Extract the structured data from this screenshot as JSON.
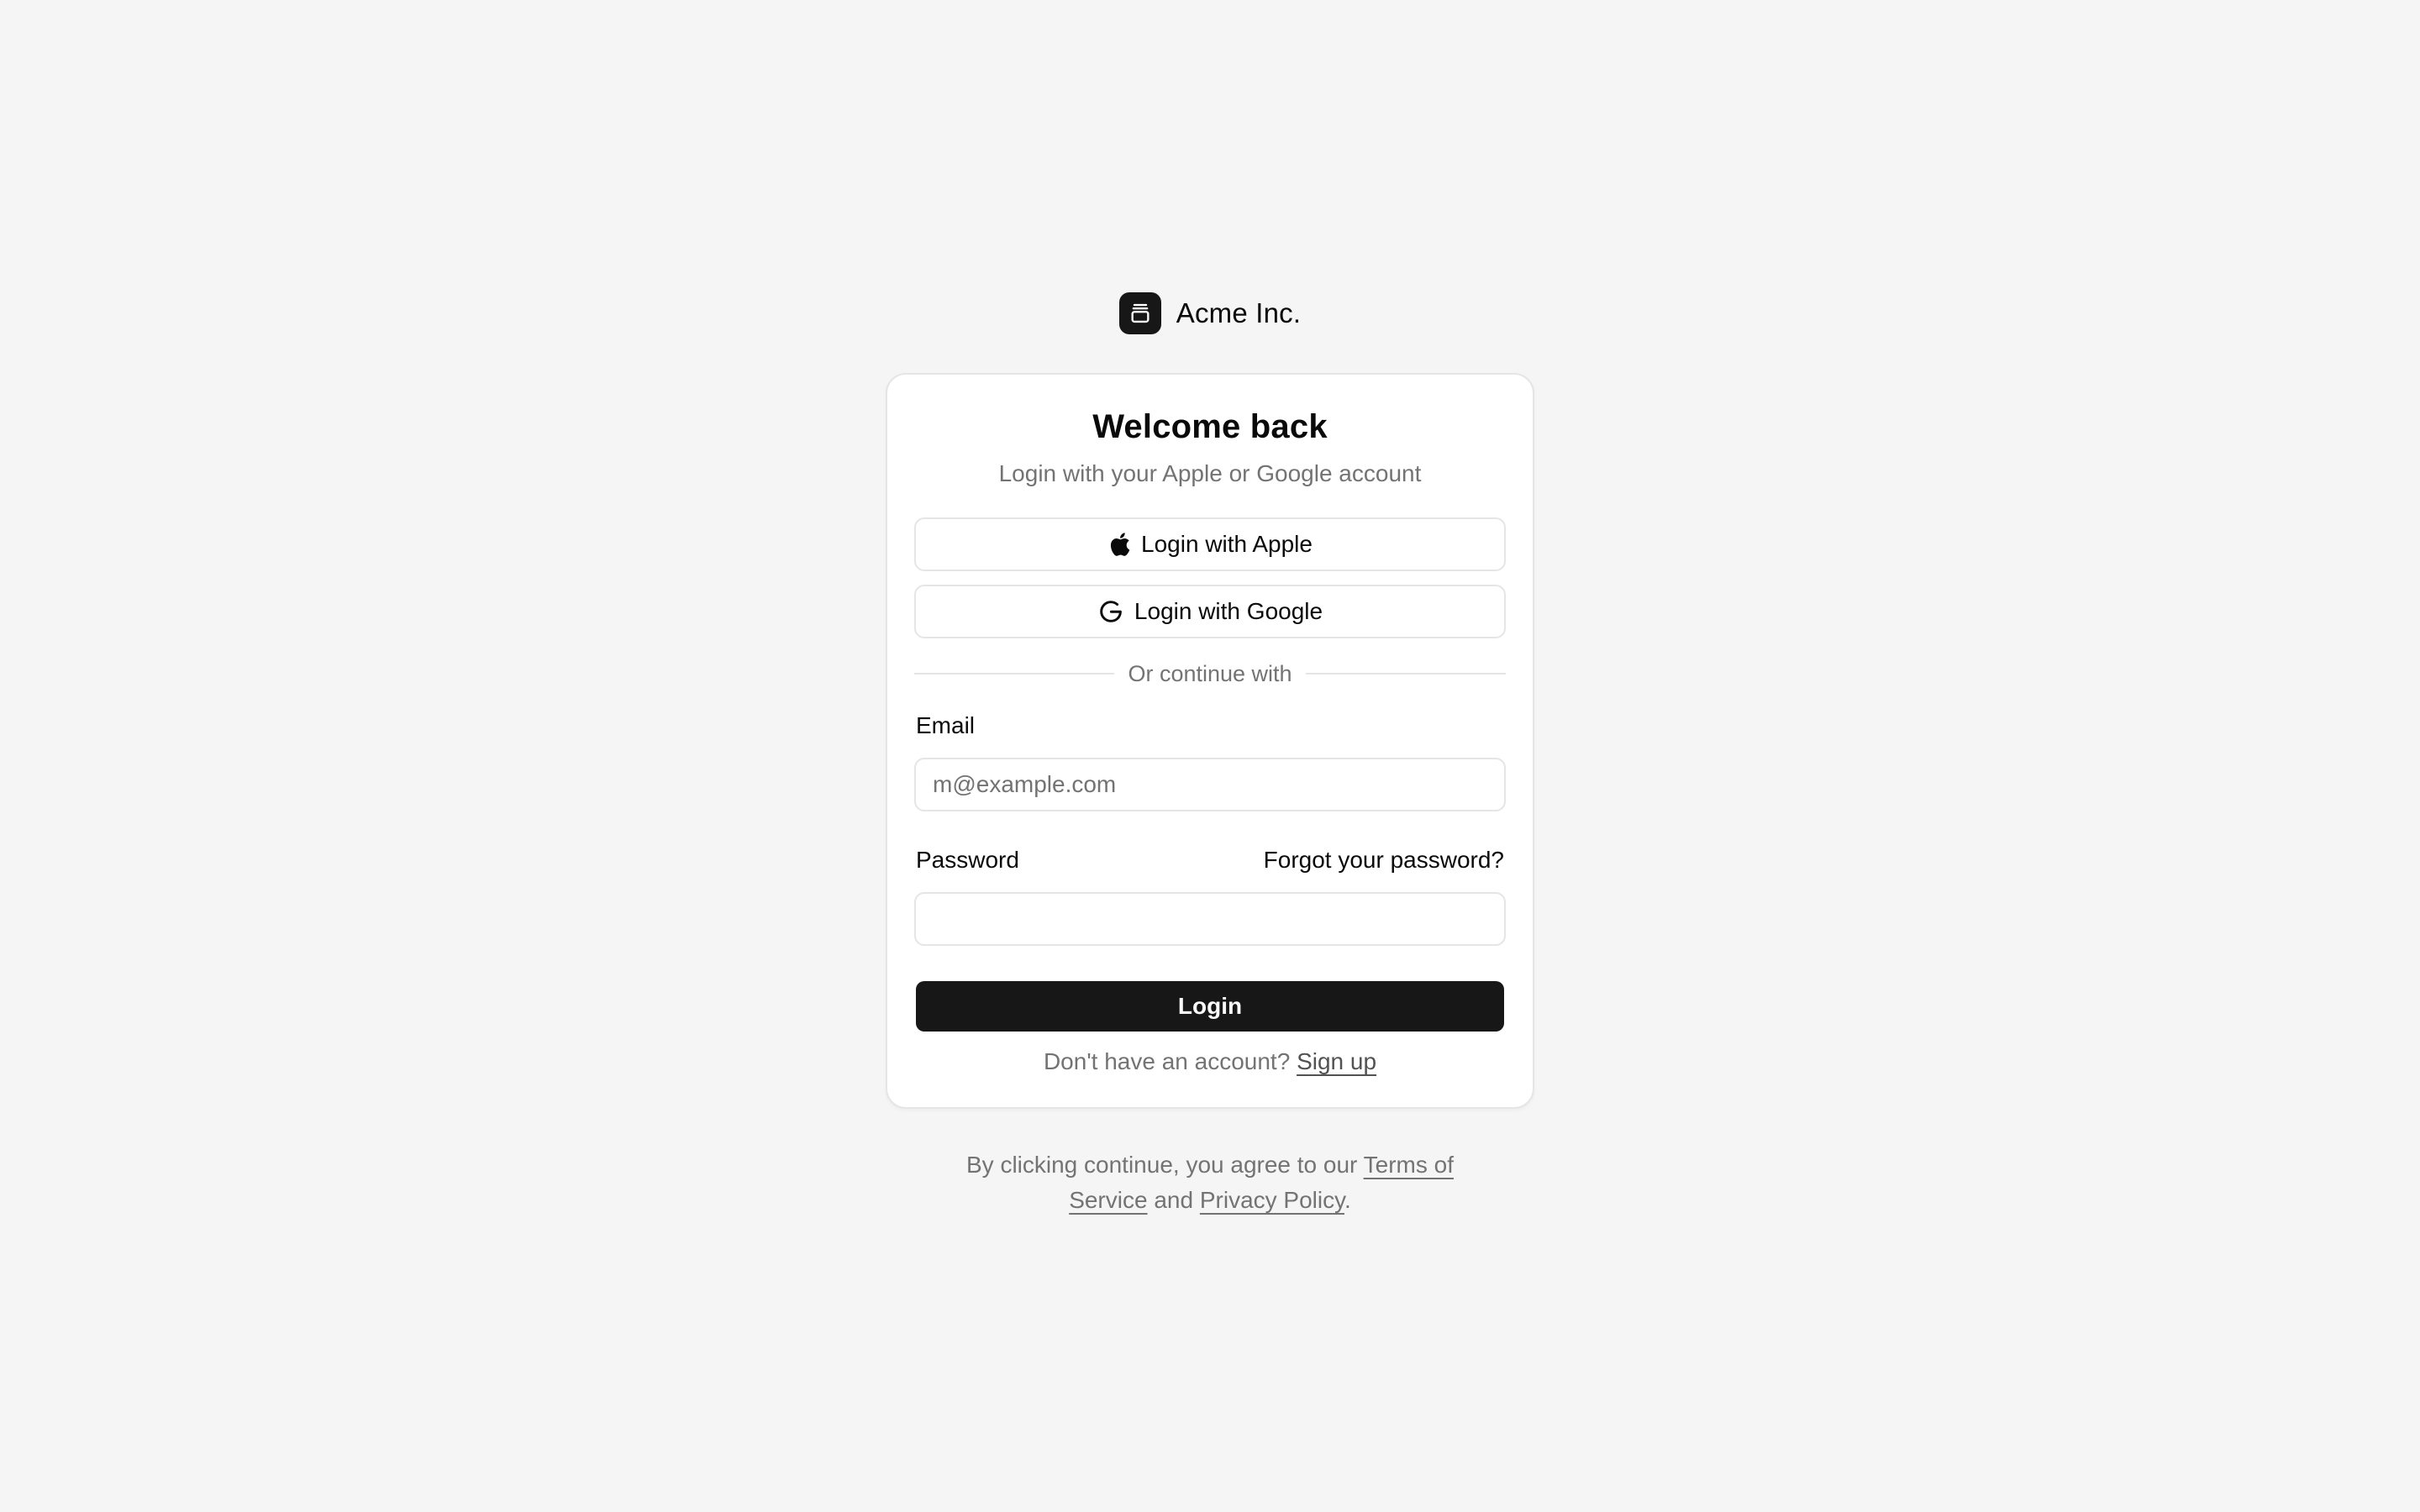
{
  "brand": {
    "name": "Acme Inc.",
    "logo_icon": "gallery-stack-icon"
  },
  "card": {
    "title": "Welcome back",
    "subtitle": "Login with your Apple or Google account",
    "apple_button": "Login with Apple",
    "google_button": "Login with Google",
    "divider_text": "Or continue with",
    "email_label": "Email",
    "email_placeholder": "m@example.com",
    "email_value": "",
    "password_label": "Password",
    "password_value": "",
    "forgot_link": "Forgot your password?",
    "login_button": "Login",
    "signup_prompt": "Don't have an account?",
    "signup_link": "Sign up"
  },
  "footer": {
    "prefix": "By clicking continue, you agree to our",
    "terms_link": "Terms of Service",
    "middle": "and",
    "privacy_link": "Privacy Policy",
    "suffix": "."
  },
  "colors": {
    "background": "#f5f5f5",
    "card": "#ffffff",
    "primary": "#171717",
    "muted_text": "#737373",
    "border": "#e5e5e5"
  }
}
